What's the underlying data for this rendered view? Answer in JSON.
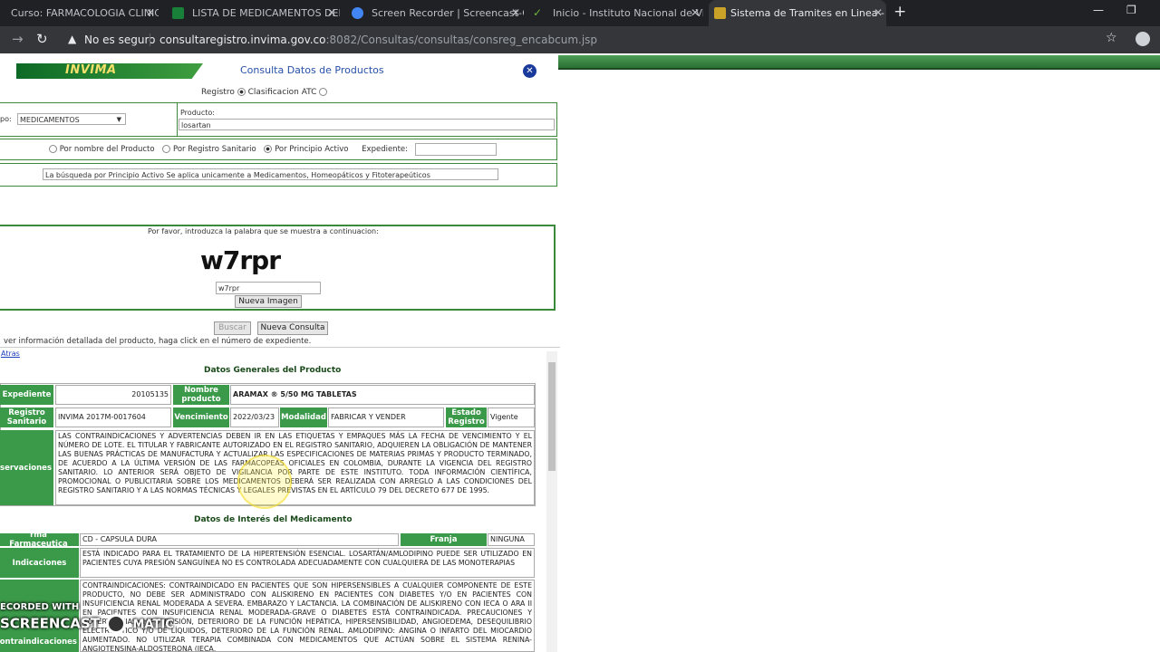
{
  "browser": {
    "tabs": [
      {
        "title": "Curso: FARMACOLOGIA CLINICA",
        "fav_color": "#e8710a"
      },
      {
        "title": "LISTA DE MEDICAMENTOS DEL P",
        "fav_color": "#188038"
      },
      {
        "title": "Screen Recorder | Screencast-O-",
        "fav_color": "#4285f4"
      },
      {
        "title": "Inicio - Instituto Nacional de Vig",
        "fav_color": "#6fb33f"
      },
      {
        "title": "Sistema de Tramites en Linea - C",
        "fav_color": "#c9a227"
      }
    ],
    "not_secure": "No es seguro",
    "url_host": "consultaregistro.invima.gov.co",
    "url_path": ":8082/Consultas/consultas/consreg_encabcum.jsp"
  },
  "header": {
    "logo": "INVIMA",
    "title": "Consulta Datos de Productos"
  },
  "search": {
    "opt_registro": "Registro",
    "opt_atc": "Clasificacion ATC",
    "grupo_label": "po:",
    "grupo_value": "MEDICAMENTOS",
    "producto_label": "Producto:",
    "producto_value": "losartan",
    "by_nombre": "Por nombre del Producto",
    "by_registro": "Por Registro Sanitario",
    "by_principio": "Por Principio Activo",
    "expediente_label": "Expediente:",
    "info": "La búsqueda por Principio Activo Se aplica unicamente a Medicamentos, Homeopáticos y Fitoterapeúticos"
  },
  "captcha": {
    "prompt": "Por favor, introduzca la palabra que se muestra a continuacion:",
    "word": "w7rpr",
    "input_value": "w7rpr",
    "refresh": "Nueva Imagen"
  },
  "actions": {
    "buscar": "Buscar",
    "nueva": "Nueva Consulta",
    "hint": "ver información detallada del producto, haga click en el número de expediente.",
    "atras": "Atras"
  },
  "general": {
    "title": "Datos Generales del Producto",
    "l_expediente": "Expediente",
    "expediente": "20105135",
    "l_nombre": "Nombre producto",
    "nombre": "ARAMAX ® 5/50 MG TABLETAS",
    "l_registro": "Registro Sanitario",
    "registro": "INVIMA 2017M-0017604",
    "l_vencimiento": "Vencimiento",
    "vencimiento": "2022/03/23",
    "l_modalidad": "Modalidad",
    "modalidad": "FABRICAR Y VENDER",
    "l_estado": "Estado Registro",
    "estado": "Vigente",
    "l_observaciones": "bservaciones",
    "observaciones": "LAS CONTRAINDICACIONES Y ADVERTENCIAS DEBEN IR EN LAS ETIQUETAS Y EMPAQUES MÁS LA FECHA DE VENCIMIENTO Y EL NÚMERO DE LOTE. EL TITULAR Y FABRICANTE AUTORIZADO EN EL REGISTRO SANITARIO, ADQUIEREN LA OBLIGACIÓN DE MANTENER LAS BUENAS PRÁCTICAS DE MANUFACTURA Y ACTUALIZAR LAS ESPECIFICACIONES DE MATERIAS PRIMAS Y PRODUCTO TERMINADO, DE ACUERDO A LA ÚLTIMA VERSIÓN DE LAS FARMACOPEAS OFICIALES EN COLOMBIA, DURANTE LA VIGENCIA DEL REGISTRO SANITARIO. LO ANTERIOR SERÁ OBJETO DE VIGILANCIA POR PARTE DE ESTE INSTITUTO. TODA INFORMACIÓN CIENTÍFICA, PROMOCIONAL O PUBLICITARIA SOBRE LOS MEDICAMENTOS DEBERÁ SER REALIZADA CON ARREGLO A LAS CONDICIONES DEL REGISTRO SANITARIO Y A LAS NORMAS TÉCNICAS Y LEGALES PREVISTAS EN EL ARTÍCULO 79 DEL DECRETO 677 DE 1995."
  },
  "interes": {
    "title": "Datos de Interés del Medicamento",
    "l_forma": "rma Farmaceutica",
    "forma": "CD - CAPSULA DURA",
    "l_franja": "Franja",
    "franja": "NINGUNA",
    "l_indicaciones": "Indicaciones",
    "indicaciones": "ESTÁ INDICADO PARA EL TRATAMIENTO DE LA HIPERTENSIÓN ESENCIAL. LOSARTÁN/AMLODIPINO PUEDE SER UTILIZADO EN PACIENTES CUYA PRESIÓN SANGUÍNEA NO ES CONTROLADA ADECUADAMENTE CON CUALQUIERA DE LAS MONOTERAPIAS",
    "l_contra": "ontraindicaciones",
    "contra": "CONTRAINDICACIONES: CONTRAINDICADO EN PACIENTES QUE SON HIPERSENSIBLES A CUALQUIER COMPONENTE DE ESTE PRODUCTO, NO DEBE SER ADMINISTRADO CON ALISKIRENO EN PACIENTES CON DIABETES Y/O EN PACIENTES CON INSUFICIENCIA RENAL MODERADA A SEVERA. EMBARAZO Y LACTANCIA. LA COMBINACIÓN DE ALISKIRENO CON IECA O ARA II EN PACIENTES CON INSUFICIENCIA RENAL MODERADA-GRAVE O DIABETES ESTÁ CONTRAINDICADA. PRECAUCIONES Y ADVERTENCIAS: HIPOTENSIÓN, DETERIORO DE LA FUNCIÓN HEPÁTICA, HIPERSENSIBILIDAD, ANGIOEDEMA, DESEQUILIBRIO ELECTROLÍTICO Y/O DE LÍQUIDOS, DETERIORO DE LA FUNCIÓN RENAL. AMLODIPINO: ANGINA O INFARTO DEL MIOCARDIO AUMENTADO. NO UTILIZAR TERAPIA COMBINADA CON MEDICAMENTOS QUE ACTÚAN SOBRE EL SISTEMA RENINA-ANGIOTENSINA-ALDOSTERONA (IECA,"
  },
  "watermark": {
    "line1": "ECORDED WITH",
    "line2": "SCREENCAST",
    "line3": "MATIC"
  }
}
